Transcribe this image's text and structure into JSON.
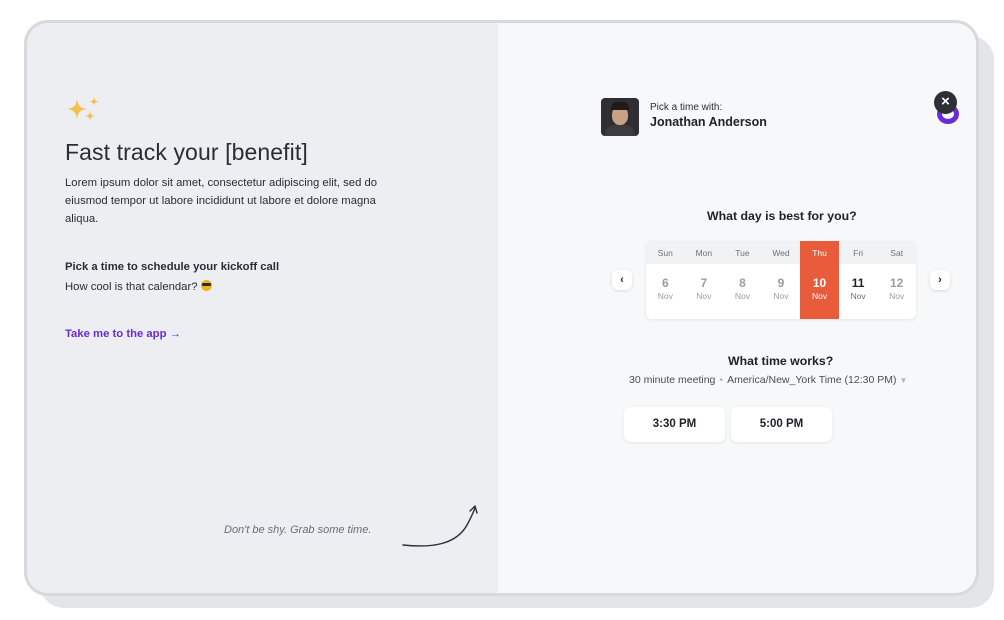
{
  "left": {
    "headline": "Fast track your [benefit]",
    "lorem": "Lorem ipsum dolor sit amet, consectetur adipiscing elit, sed do eiusmod tempor ut labore incididunt ut labore et dolore magna aliqua.",
    "pick_title": "Pick a time to schedule your kickoff call",
    "pick_sub": "How cool is that calendar?",
    "app_link": "Take me to the app →",
    "shy_note": "Don't be shy. Grab some time.",
    "sparkle_icon": "sparkles-icon",
    "sparkle_color": "#f5c04a",
    "link_color": "#6c2bd9"
  },
  "host": {
    "label": "Pick a time with:",
    "name": "Jonathan Anderson"
  },
  "close_label": "×",
  "calendar": {
    "question": "What day is best for you?",
    "prev_label": "‹",
    "next_label": "›",
    "selected_color": "#e85c3c",
    "days": [
      {
        "dow": "Sun",
        "num": "6",
        "mon": "Nov",
        "state": "disabled"
      },
      {
        "dow": "Mon",
        "num": "7",
        "mon": "Nov",
        "state": "disabled"
      },
      {
        "dow": "Tue",
        "num": "8",
        "mon": "Nov",
        "state": "disabled"
      },
      {
        "dow": "Wed",
        "num": "9",
        "mon": "Nov",
        "state": "disabled"
      },
      {
        "dow": "Thu",
        "num": "10",
        "mon": "Nov",
        "state": "selected"
      },
      {
        "dow": "Fri",
        "num": "11",
        "mon": "Nov",
        "state": "available"
      },
      {
        "dow": "Sat",
        "num": "12",
        "mon": "Nov",
        "state": "disabled"
      }
    ]
  },
  "times": {
    "question": "What time works?",
    "duration": "30 minute meeting",
    "timezone": "America/New_York Time (12:30 PM)",
    "slots": [
      "3:30 PM",
      "5:00 PM"
    ]
  }
}
